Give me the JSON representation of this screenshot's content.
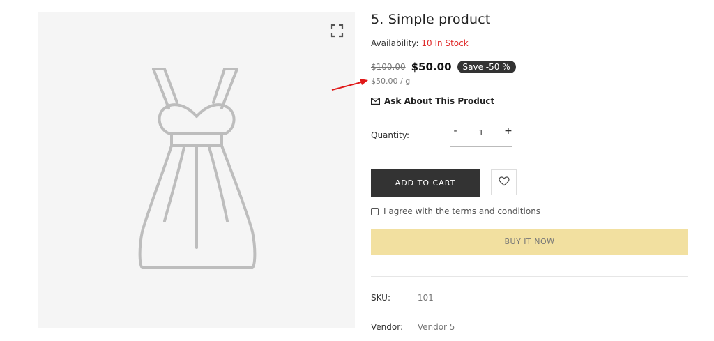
{
  "product": {
    "title": "5. Simple product",
    "availability_label": "Availability:",
    "availability_value": "10 In Stock",
    "old_price": "$100.00",
    "new_price": "$50.00",
    "save_badge": "Save -50 %",
    "unit_price": "$50.00 / g",
    "ask_label": "Ask About This Product"
  },
  "quantity": {
    "label": "Quantity:",
    "minus": "-",
    "value": "1",
    "plus": "+"
  },
  "actions": {
    "add_to_cart": "ADD TO CART",
    "terms": "I agree with the terms and conditions",
    "buy_now": "BUY IT NOW"
  },
  "meta": {
    "sku_label": "SKU:",
    "sku_value": "101",
    "vendor_label": "Vendor:",
    "vendor_value": "Vendor 5"
  },
  "icons": {
    "expand": "expand-icon",
    "mail": "mail-icon",
    "heart": "heart-icon",
    "annotation": "red-arrow"
  },
  "colors": {
    "stock": "#e02b2b",
    "cart_button": "#333333",
    "buy_now": "#f2e0a0",
    "badge": "#333333",
    "annotation_arrow": "#e01818"
  }
}
